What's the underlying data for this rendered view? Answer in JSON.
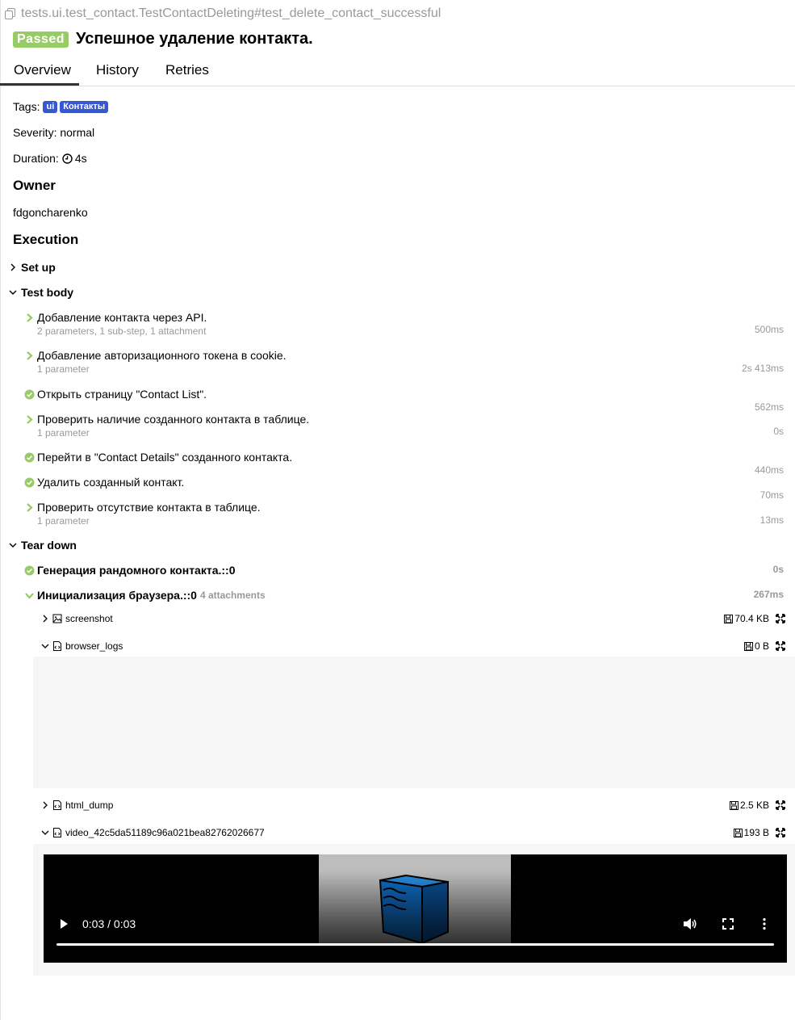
{
  "header": {
    "test_path": "tests.ui.test_contact.TestContactDeleting#test_delete_contact_successful",
    "status_badge": "Passed",
    "title": "Успешное удаление контакта."
  },
  "tabs": [
    {
      "label": "Overview",
      "active": true
    },
    {
      "label": "History",
      "active": false
    },
    {
      "label": "Retries",
      "active": false
    }
  ],
  "overview": {
    "tags_label": "Tags:",
    "tags": [
      "ui",
      "Контакты"
    ],
    "severity": "Severity: normal",
    "duration_label": "Duration:",
    "duration_value": "4s",
    "owner_heading": "Owner",
    "owner": "fdgoncharenko",
    "execution_heading": "Execution"
  },
  "execution": {
    "setup_label": "Set up",
    "test_body_label": "Test body",
    "steps": [
      {
        "name": "Добавление контакта через API.",
        "details": "2 parameters, 1 sub-step, 1 attachment",
        "duration": "500ms",
        "icon": "chevron-right-icon"
      },
      {
        "name": "Добавление авторизационного токена в cookie.",
        "details": "1 parameter",
        "duration": "2s 413ms",
        "icon": "chevron-right-icon"
      },
      {
        "name": "Открыть страницу \"Contact List\".",
        "details": "",
        "duration": "562ms",
        "icon": "check-circle-icon"
      },
      {
        "name": "Проверить наличие созданного контакта в таблице.",
        "details": "1 parameter",
        "duration": "0s",
        "icon": "chevron-right-icon"
      },
      {
        "name": "Перейти в \"Contact Details\" созданного контакта.",
        "details": "",
        "duration": "440ms",
        "icon": "check-circle-icon"
      },
      {
        "name": "Удалить созданный контакт.",
        "details": "",
        "duration": "70ms",
        "icon": "check-circle-icon"
      },
      {
        "name": "Проверить отсутствие контакта в таблице.",
        "details": "1 parameter",
        "duration": "13ms",
        "icon": "chevron-right-icon"
      }
    ],
    "teardown_label": "Tear down",
    "teardown_steps": [
      {
        "name": "Генерация рандомного контакта.::0",
        "details": "",
        "duration": "0s"
      },
      {
        "name": "Инициализация браузера.::0",
        "details": "4 attachments",
        "duration": "267ms"
      }
    ],
    "attachments": [
      {
        "name": "screenshot",
        "size": "70.4 KB",
        "expanded": false,
        "icon": "image-file-icon"
      },
      {
        "name": "browser_logs",
        "size": "0 B",
        "expanded": true,
        "icon": "code-file-icon"
      },
      {
        "name": "html_dump",
        "size": "2.5 KB",
        "expanded": false,
        "icon": "code-file-icon"
      },
      {
        "name": "video_42c5da51189c96a021bea82762026677",
        "size": "193 B",
        "expanded": true,
        "icon": "code-file-icon"
      }
    ],
    "video": {
      "time": "0:03 / 0:03",
      "progress": 1.0
    }
  },
  "colors": {
    "passed": "#97cc64",
    "tag": "#3558d3",
    "check": "#97cc64",
    "muted": "#999999"
  }
}
